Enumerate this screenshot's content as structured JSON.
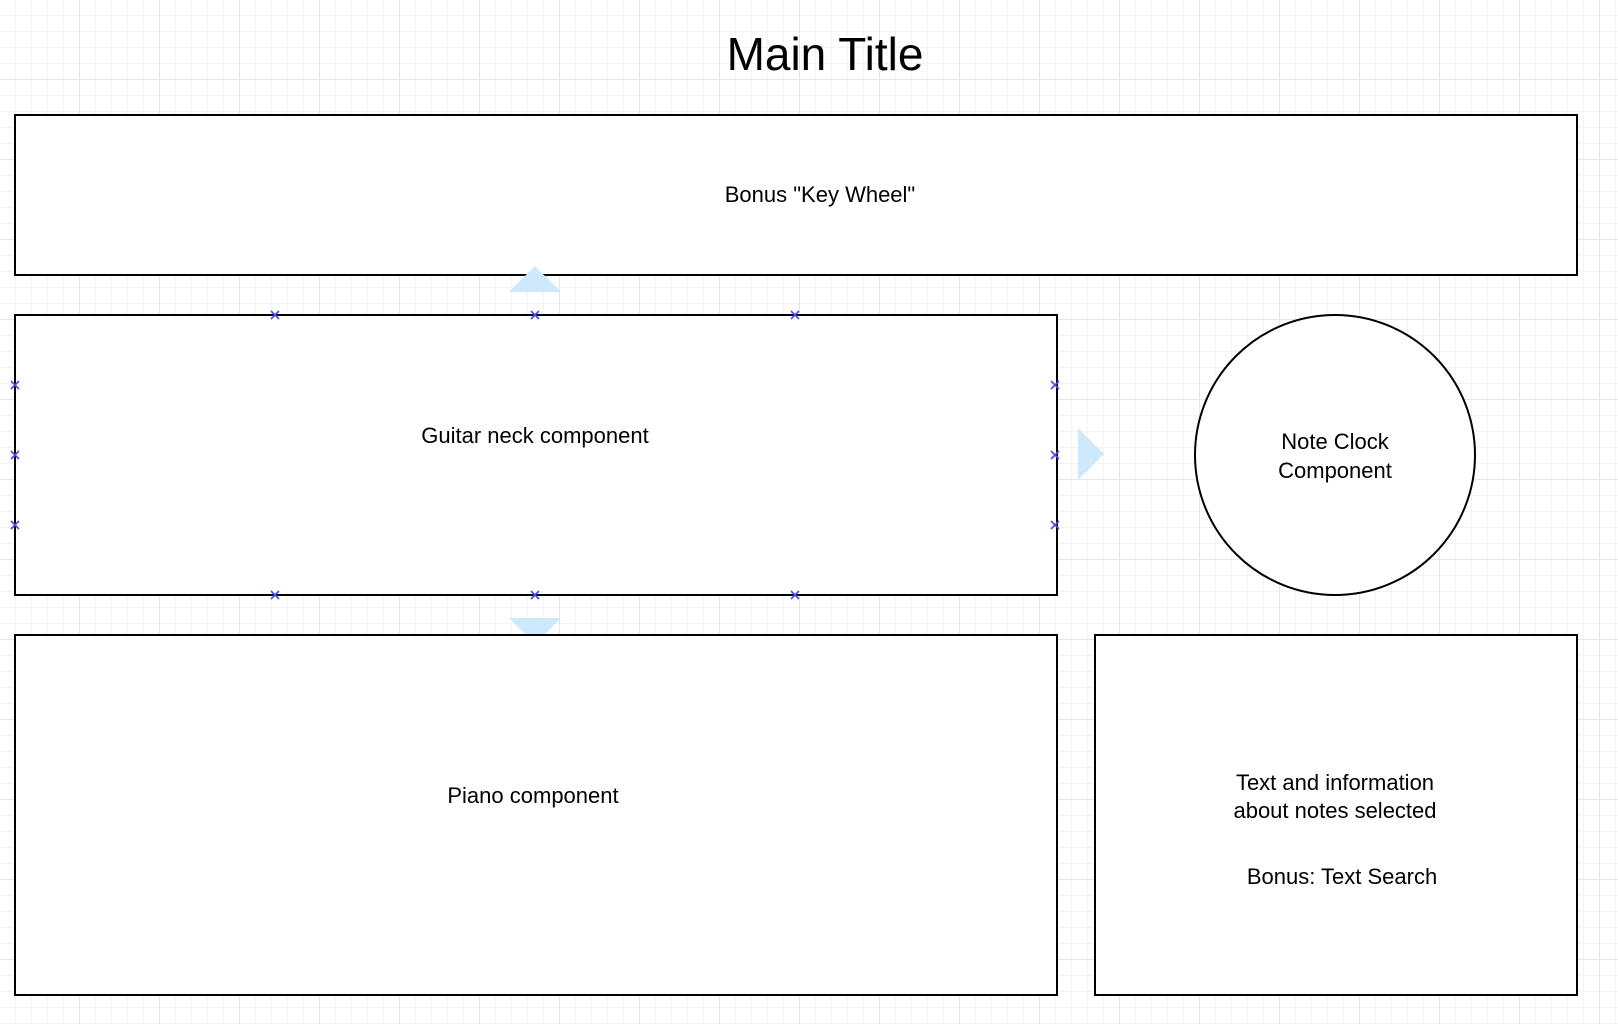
{
  "diagram": {
    "title": "Main Title",
    "shapes": [
      {
        "id": "key-wheel",
        "label": "Bonus \"Key Wheel\""
      },
      {
        "id": "guitar-neck",
        "label": "Guitar neck component"
      },
      {
        "id": "note-clock",
        "label_line1": "Note Clock",
        "label_line2": "Component"
      },
      {
        "id": "piano",
        "label": "Piano component"
      },
      {
        "id": "text-info",
        "label_line1": "Text and information",
        "label_line2": "about notes selected",
        "label_line3": "Bonus: Text Search"
      }
    ],
    "colors": {
      "stroke": "#000000",
      "selection_handle": "#4a4af0",
      "hover_arrow": "#cde9fb",
      "grid": "#e6e6e6"
    }
  }
}
